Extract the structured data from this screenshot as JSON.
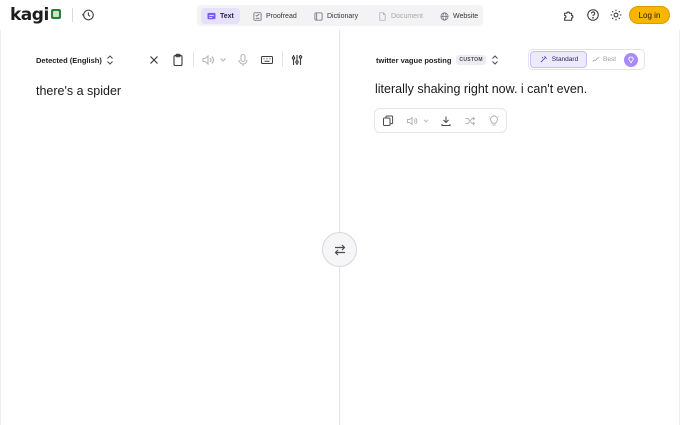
{
  "header": {
    "logo_text": "kagi",
    "tabs": [
      {
        "label": "Text",
        "state": "active"
      },
      {
        "label": "Proofread",
        "state": "normal"
      },
      {
        "label": "Dictionary",
        "state": "normal"
      },
      {
        "label": "Document",
        "state": "disabled"
      },
      {
        "label": "Website",
        "state": "normal"
      }
    ],
    "login_label": "Log in"
  },
  "source": {
    "language": "Detected (English)",
    "text": "there's a spider"
  },
  "target": {
    "language": "twitter vague posting",
    "badge": "CUSTOM",
    "quality_standard": "Standard",
    "quality_best": "Best",
    "text": "literally shaking right now. i can't even."
  },
  "colors": {
    "accent": "#f7b500",
    "active_tab_bg": "#e6e1fb",
    "standard_bg": "#ede9fe",
    "gem": "#a78bfa"
  },
  "icons": [
    "history-icon",
    "text-tab-icon",
    "proofread-icon",
    "dictionary-icon",
    "document-icon",
    "globe-icon",
    "extension-icon",
    "help-icon",
    "gear-icon",
    "clear-icon",
    "clipboard-icon",
    "speaker-icon",
    "chevron-down-icon",
    "microphone-icon",
    "keyboard-icon",
    "sliders-icon",
    "swap-icon",
    "chevron-updown-icon",
    "sparkle-icon",
    "wave-icon",
    "gem-icon",
    "copy-icon",
    "download-icon",
    "shuffle-icon",
    "lightbulb-icon"
  ]
}
